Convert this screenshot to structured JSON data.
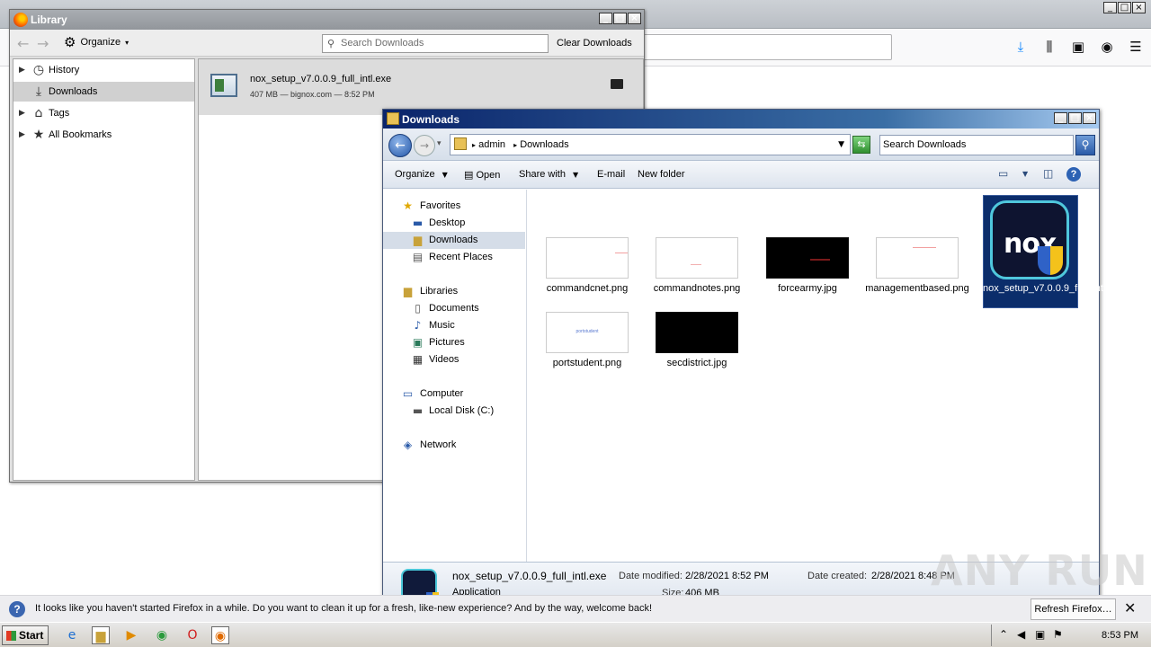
{
  "firefox": {
    "window_buttons": [
      "_",
      "□",
      "×"
    ],
    "toolbar_icons": [
      "download-icon",
      "library-icon",
      "sidebar-icon",
      "account-icon",
      "menu-icon"
    ]
  },
  "notification": {
    "text": "It looks like you haven't started Firefox in a while. Do you want to clean it up for a fresh, like-new experience? And by the way, welcome back!",
    "button_label": "Refresh Firefox…",
    "close": "✕"
  },
  "library": {
    "title": "Library",
    "toolbar": {
      "organize": "Organize",
      "search_placeholder": "Search Downloads",
      "clear_downloads": "Clear Downloads"
    },
    "tree": [
      {
        "label": "History",
        "icon": "clock-icon"
      },
      {
        "label": "Downloads",
        "icon": "download-icon"
      },
      {
        "label": "Tags",
        "icon": "tag-icon"
      },
      {
        "label": "All Bookmarks",
        "icon": "star-icon"
      }
    ],
    "download": {
      "name": "nox_setup_v7.0.0.9_full_intl.exe",
      "meta": "407 MB — bignox.com — 8:52 PM"
    }
  },
  "explorer": {
    "title": "Downloads",
    "address": {
      "crumb1": "admin",
      "crumb2": "Downloads"
    },
    "search_placeholder": "Search Downloads",
    "commands": {
      "organize": "Organize",
      "open": "Open",
      "share_with": "Share with",
      "email": "E-mail",
      "new_folder": "New folder"
    },
    "nav": {
      "favorites": "Favorites",
      "desktop": "Desktop",
      "downloads": "Downloads",
      "recent_places": "Recent Places",
      "libraries": "Libraries",
      "documents": "Documents",
      "music": "Music",
      "pictures": "Pictures",
      "videos": "Videos",
      "computer": "Computer",
      "local_disk": "Local Disk (C:)",
      "network": "Network"
    },
    "files": [
      {
        "name": "commandcnet.png",
        "thumb": "light"
      },
      {
        "name": "commandnotes.png",
        "thumb": "light"
      },
      {
        "name": "forcearmy.jpg",
        "thumb": "dark"
      },
      {
        "name": "managementbased.png",
        "thumb": "light"
      },
      {
        "name": "nox_setup_v7.0.0.9_full_intl.exe",
        "thumb": "nox"
      },
      {
        "name": "portstudent.png",
        "thumb": "light"
      },
      {
        "name": "secdistrict.jpg",
        "thumb": "dark"
      }
    ],
    "thumb_text": {
      "portstudent": "portstudent"
    },
    "details": {
      "name": "nox_setup_v7.0.0.9_full_intl.exe",
      "type": "Application",
      "date_modified_label": "Date modified:",
      "date_modified": "2/28/2021 8:52 PM",
      "size_label": "Size:",
      "size": "406 MB",
      "date_created_label": "Date created:",
      "date_created": "2/28/2021 8:48 PM"
    }
  },
  "taskbar": {
    "start": "Start",
    "clock": "8:53 PM"
  },
  "watermark": "ANY RUN"
}
